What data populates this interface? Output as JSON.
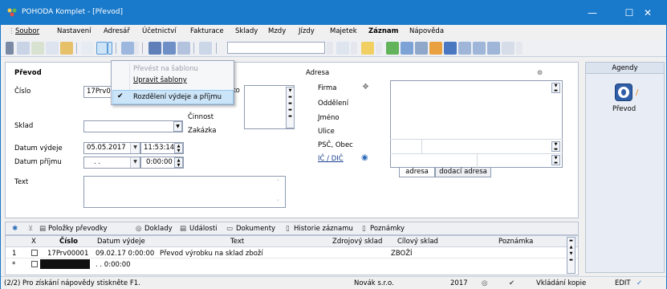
{
  "window": {
    "title": "POHODA Komplet - [Převod]",
    "minimize": "—",
    "maximize": "☐",
    "close": "✕"
  },
  "menu": [
    "Soubor",
    "Nastavení",
    "Adresář",
    "Účetnictví",
    "Fakturace",
    "Sklady",
    "Mzdy",
    "Jízdy",
    "Majetek",
    "Záznam",
    "Nápověda"
  ],
  "context_menu": {
    "items": [
      "Převést na šablonu",
      "Upravit šablony",
      "Rozdělení výdeje a příjmu"
    ],
    "checked_index": 2,
    "disabled_index": 0
  },
  "form": {
    "section_title": "Převod",
    "cislo_label": "Číslo",
    "cislo_value": "17Prv00",
    "cislo_value_suffix": "ko",
    "cinnost_label": "Činnost",
    "zakazka_label": "Zakázka",
    "sklad_label": "Sklad",
    "sklad_value": "",
    "datum_vydeje_label": "Datum výdeje",
    "datum_vydeje_value": "05.05.2017",
    "cas_vydeje_value": "11:53:14",
    "datum_prijmu_label": "Datum příjmu",
    "datum_prijmu_value": ". .",
    "cas_prijmu_value": "0:00:00",
    "text_label": "Text",
    "text_value": ""
  },
  "address": {
    "title": "Adresa",
    "labels": [
      "Firma",
      "Oddělení",
      "Jméno",
      "Ulice",
      "PSČ, Obec"
    ],
    "ic_dic_label": "IČ / DIČ",
    "tabs": [
      "adresa",
      "dodací adresa"
    ]
  },
  "agenda": {
    "title": "Agendy",
    "item_label": "Převod"
  },
  "bottom_tabs": [
    "Položky převodky",
    "Doklady",
    "Události",
    "Dokumenty",
    "Historie záznamu",
    "Poznámky"
  ],
  "grid": {
    "headers": [
      "X",
      "Číslo",
      "Datum výdeje",
      "Text",
      "Zdrojový sklad",
      "Cílový sklad",
      "Poznámka"
    ],
    "rows": [
      {
        "index": "1",
        "cislo": "17Prv00001",
        "datum": "09.02.17 0:00:00",
        "text": "Převod výrobku na sklad zboží",
        "zdroj": "",
        "cil": "ZBOŽÍ",
        "poznamka": ""
      },
      {
        "index": "*",
        "cislo": "",
        "datum": ". . 0:00:00",
        "text": "",
        "zdroj": "",
        "cil": "",
        "poznamka": ""
      }
    ]
  },
  "status": {
    "help": "(2/2) Pro získání nápovědy stiskněte F1.",
    "company": "Novák s.r.o.",
    "year": "2017",
    "mode": "Vkládání kopie",
    "edit": "EDIT"
  },
  "colors": {
    "titlebar": "#1979ca",
    "accent": "#2a6ab8",
    "selection": "#cce4f7"
  }
}
